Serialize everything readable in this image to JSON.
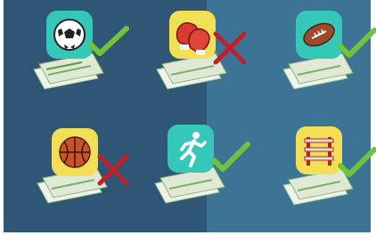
{
  "colors": {
    "panel_left": "#2f5674",
    "panel_right": "#3d7496",
    "check": "#6fc43a",
    "cross": "#c0202a",
    "money": "#dfe9d6"
  },
  "tiles": [
    {
      "icon": "soccer-ball-icon",
      "box_color": "#35c7b8",
      "status": "correct"
    },
    {
      "icon": "boxing-gloves-icon",
      "box_color": "#f3df55",
      "status": "wrong"
    },
    {
      "icon": "american-football-icon",
      "box_color": "#35c7b8",
      "status": "correct"
    },
    {
      "icon": "basketball-icon",
      "box_color": "#f3df55",
      "status": "wrong"
    },
    {
      "icon": "runner-icon",
      "box_color": "#35c7b8",
      "status": "correct"
    },
    {
      "icon": "hurdle-icon",
      "box_color": "#f3df55",
      "status": "correct"
    }
  ]
}
